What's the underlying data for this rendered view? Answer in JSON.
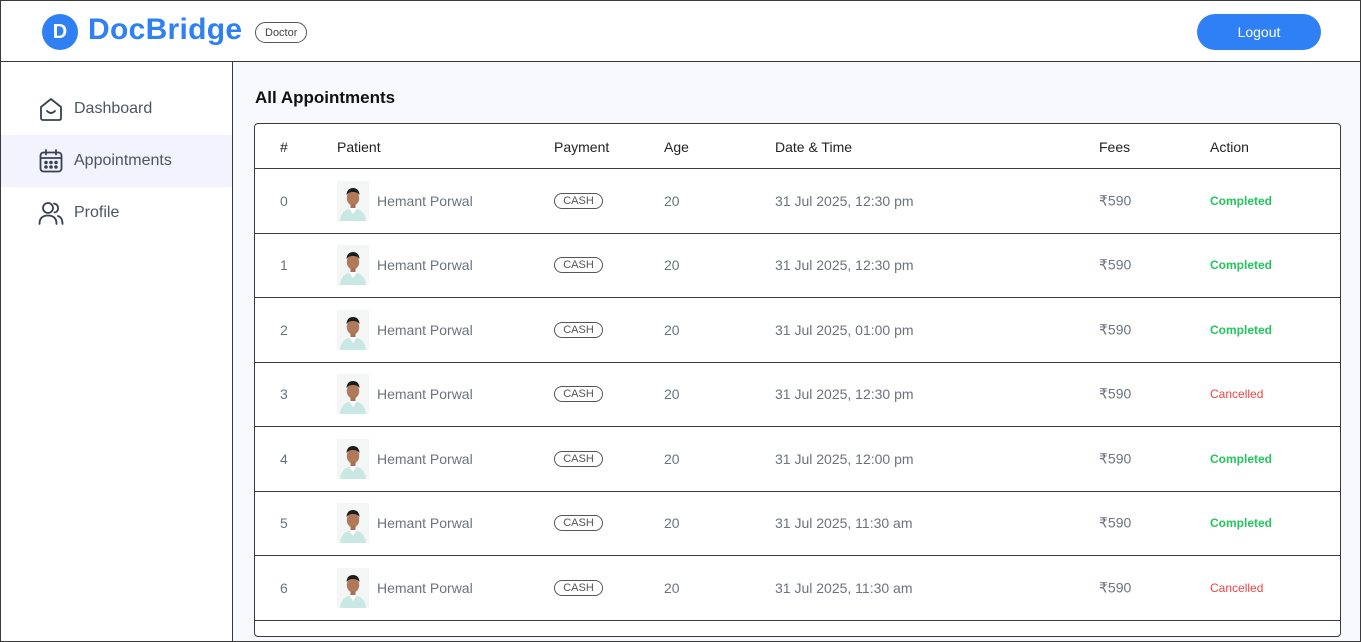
{
  "header": {
    "logo_letter": "D",
    "brand": "DocBridge",
    "role": "Doctor",
    "logout_label": "Logout"
  },
  "sidebar": {
    "items": [
      {
        "label": "Dashboard",
        "icon": "home-icon"
      },
      {
        "label": "Appointments",
        "icon": "calendar-icon",
        "active": true
      },
      {
        "label": "Profile",
        "icon": "users-icon"
      }
    ]
  },
  "main": {
    "title": "All Appointments",
    "columns": [
      "#",
      "Patient",
      "Payment",
      "Age",
      "Date & Time",
      "Fees",
      "Action"
    ],
    "rows": [
      {
        "index": "0",
        "patient": "Hemant Porwal",
        "payment": "CASH",
        "age": "20",
        "datetime": "31 Jul 2025, 12:30 pm",
        "fees": "₹590",
        "status": "Completed"
      },
      {
        "index": "1",
        "patient": "Hemant Porwal",
        "payment": "CASH",
        "age": "20",
        "datetime": "31 Jul 2025, 12:30 pm",
        "fees": "₹590",
        "status": "Completed"
      },
      {
        "index": "2",
        "patient": "Hemant Porwal",
        "payment": "CASH",
        "age": "20",
        "datetime": "31 Jul 2025, 01:00 pm",
        "fees": "₹590",
        "status": "Completed"
      },
      {
        "index": "3",
        "patient": "Hemant Porwal",
        "payment": "CASH",
        "age": "20",
        "datetime": "31 Jul 2025, 12:30 pm",
        "fees": "₹590",
        "status": "Cancelled"
      },
      {
        "index": "4",
        "patient": "Hemant Porwal",
        "payment": "CASH",
        "age": "20",
        "datetime": "31 Jul 2025, 12:00 pm",
        "fees": "₹590",
        "status": "Completed"
      },
      {
        "index": "5",
        "patient": "Hemant Porwal",
        "payment": "CASH",
        "age": "20",
        "datetime": "31 Jul 2025, 11:30 am",
        "fees": "₹590",
        "status": "Completed"
      },
      {
        "index": "6",
        "patient": "Hemant Porwal",
        "payment": "CASH",
        "age": "20",
        "datetime": "31 Jul 2025, 11:30 am",
        "fees": "₹590",
        "status": "Cancelled"
      }
    ]
  },
  "colors": {
    "brand": "#2f7ff5",
    "completed": "#22c55e",
    "cancelled": "#ef4444",
    "active_nav_bg": "#f2f3ff"
  }
}
